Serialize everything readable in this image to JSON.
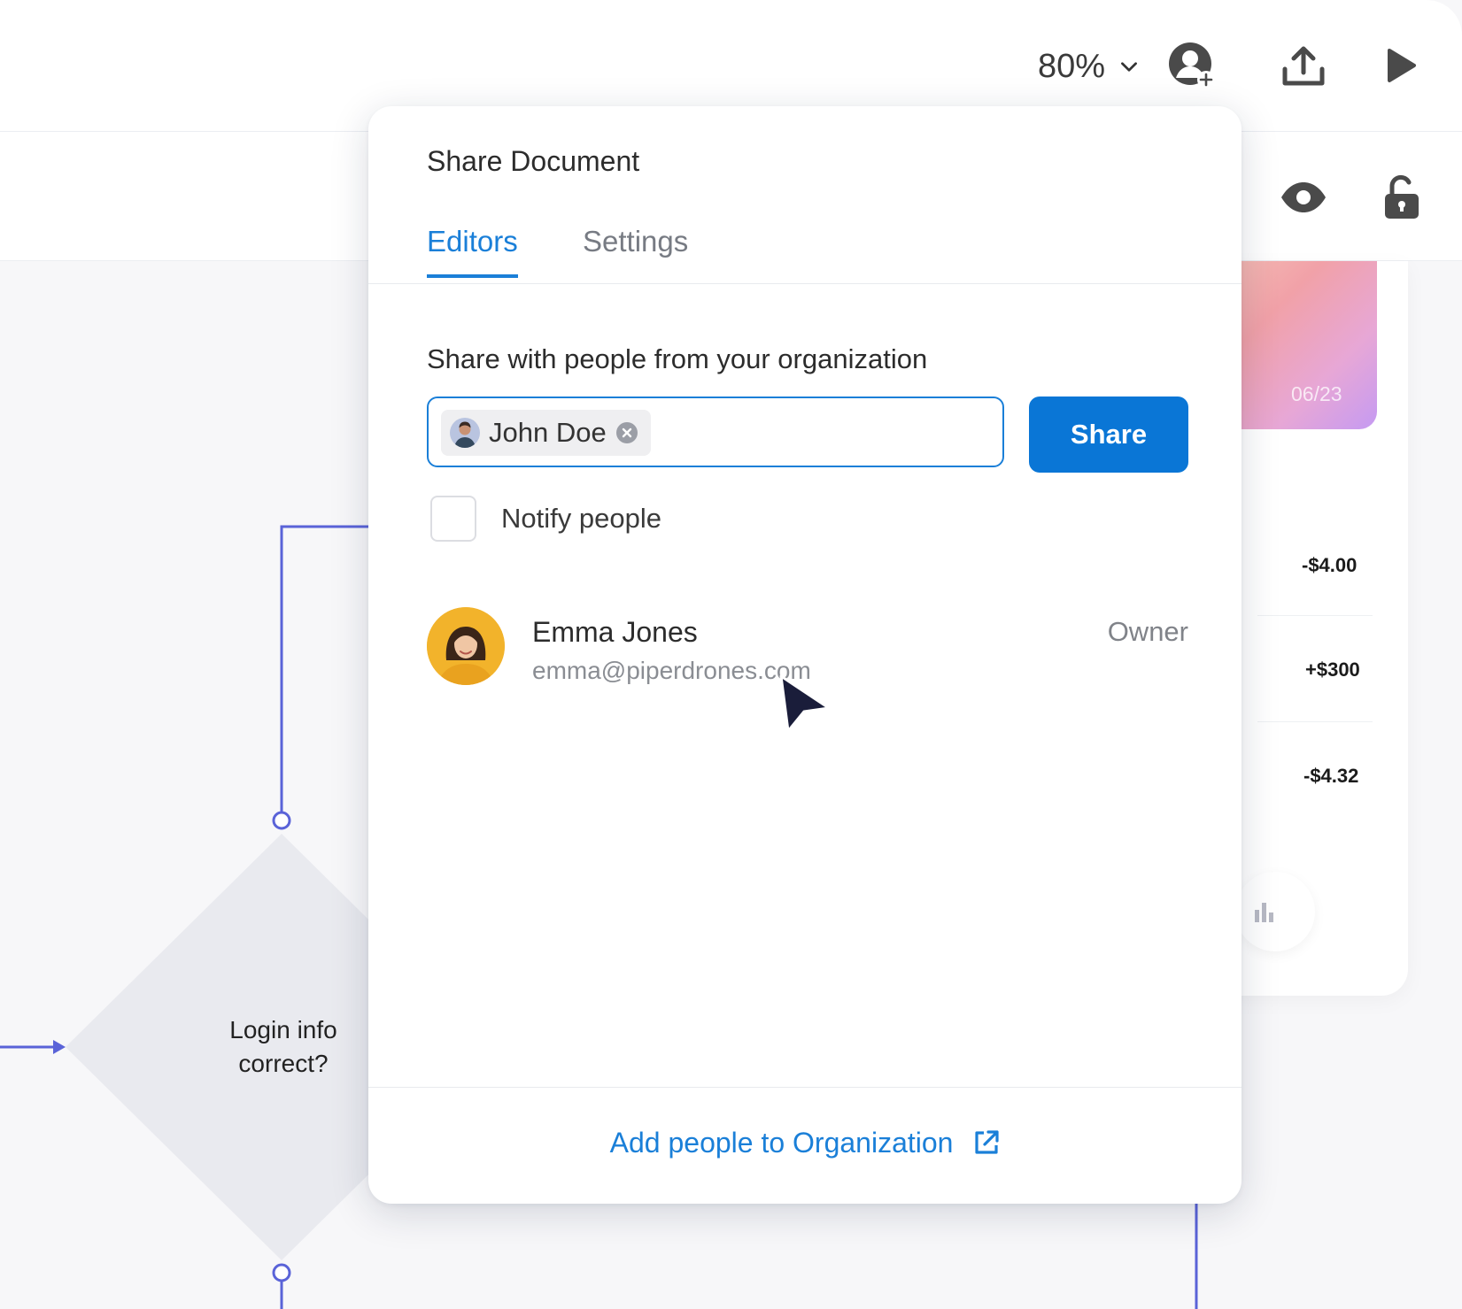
{
  "toolbar": {
    "zoom_value": "80%",
    "icons": [
      "add-user-icon",
      "upload-icon",
      "play-icon",
      "eye-icon",
      "unlock-icon"
    ]
  },
  "canvas": {
    "decision_label": "Login info correct?",
    "card_date": "06/23",
    "transactions": [
      {
        "amount": "-$4.00"
      },
      {
        "amount": "+$300"
      },
      {
        "amount": "-$4.32"
      }
    ]
  },
  "share_dialog": {
    "title": "Share Document",
    "tabs": [
      {
        "label": "Editors",
        "active": true
      },
      {
        "label": "Settings",
        "active": false
      }
    ],
    "share_label": "Share with people from your organization",
    "recipients": [
      {
        "name": "John Doe"
      }
    ],
    "share_button": "Share",
    "notify_label": "Notify people",
    "notify_checked": false,
    "members": [
      {
        "name": "Emma Jones",
        "email": "emma@piperdrones.com",
        "role": "Owner"
      }
    ],
    "footer_link": "Add people to Organization"
  },
  "colors": {
    "accent": "#1a7fd8",
    "primary_button": "#0a76d6",
    "flow_line": "#5a63d8",
    "avatar_bg": "#f2b32b"
  }
}
